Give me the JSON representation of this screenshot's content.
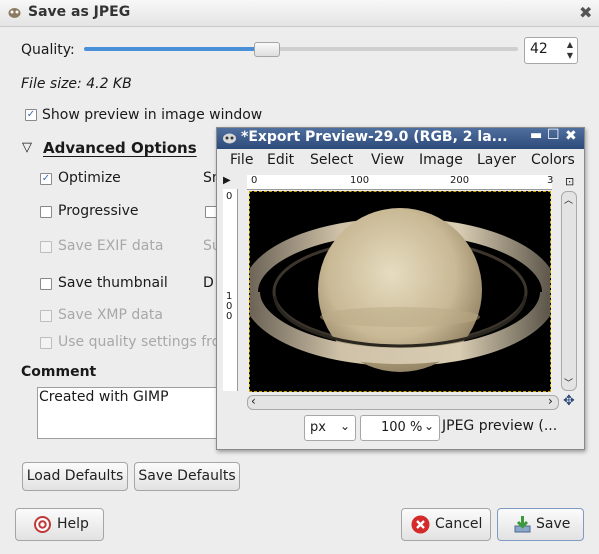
{
  "dialog": {
    "title": "Save as JPEG",
    "quality_label": "Quality:",
    "quality_value": "42",
    "quality_fraction": 0.42,
    "file_size": "File size: 4.2 KB",
    "show_preview_label": "Show preview in image window",
    "show_preview_checked": true,
    "advanced_label": "Advanced Options",
    "options": [
      {
        "label": "Optimize",
        "checked": true,
        "disabled": false
      },
      {
        "label": "Progressive",
        "checked": false,
        "disabled": false
      },
      {
        "label": "Save EXIF data",
        "checked": false,
        "disabled": true
      },
      {
        "label": "Save thumbnail",
        "checked": false,
        "disabled": false
      },
      {
        "label": "Save XMP data",
        "checked": false,
        "disabled": true
      },
      {
        "label": "Use quality settings fro",
        "checked": false,
        "disabled": true
      }
    ],
    "right_col_fragments": [
      "Sm",
      "",
      "Su",
      "D"
    ],
    "comment_label": "Comment",
    "comment_text": "Created with GIMP",
    "load_defaults": "Load Defaults",
    "save_defaults": "Save Defaults",
    "help": "Help",
    "cancel": "Cancel",
    "save": "Save"
  },
  "preview_window": {
    "title": "*Export Preview-29.0 (RGB, 2 la...",
    "menu": [
      "File",
      "Edit",
      "Select",
      "View",
      "Image",
      "Layer",
      "Colors"
    ],
    "ruler_h_ticks": [
      "0",
      "100",
      "200",
      "3"
    ],
    "ruler_v_ticks": [
      "0",
      "1",
      "0",
      "0"
    ],
    "unit": "px",
    "zoom": "100 %",
    "status": "JPEG preview (..."
  },
  "colors": {
    "accent": "#4a90d9",
    "titlebar_active": "#3a5a8c",
    "cancel_red": "#d42a2a",
    "save_green": "#3c9a3c"
  }
}
